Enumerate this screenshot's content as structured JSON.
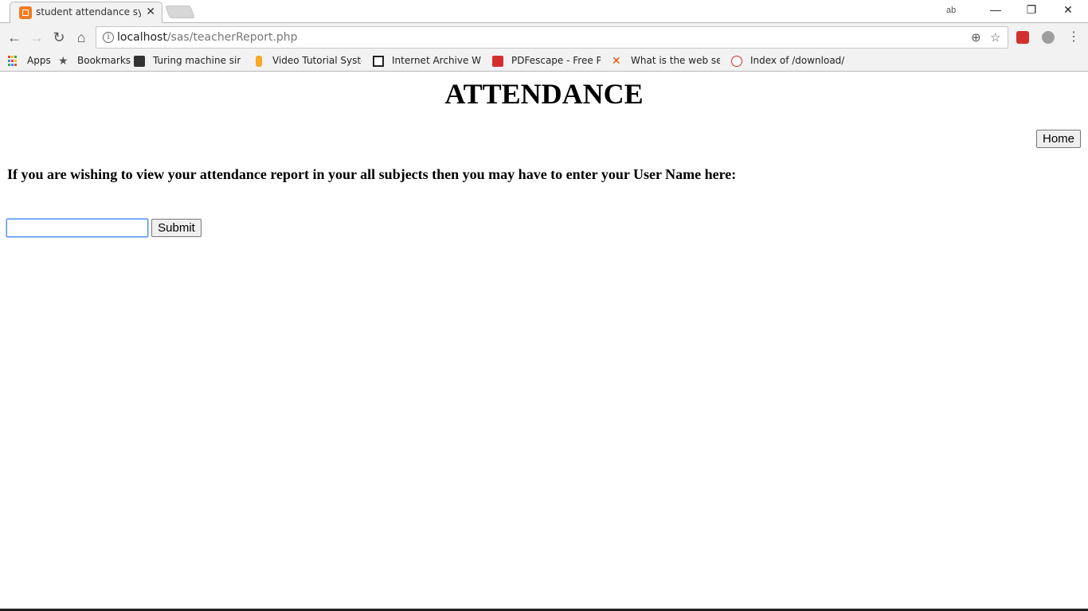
{
  "browser": {
    "tab": {
      "title": "student attendance system",
      "close_glyph": "✕"
    },
    "window_controls": {
      "minimize": "—",
      "restore": "❐",
      "close": "✕"
    },
    "profile_label": "ab",
    "toolbar": {
      "back": "←",
      "forward": "→",
      "reload": "↻",
      "home": "⌂",
      "url_host": "localhost",
      "url_path": "/sas/teacherReport.php",
      "info": "i",
      "zoom_icon": "⊕",
      "star_icon": "☆",
      "menu": "⋮"
    },
    "bookmarks": [
      {
        "label": "Apps",
        "icon": "apps-grid-icon"
      },
      {
        "label": "Bookmarks",
        "icon": "star-icon"
      },
      {
        "label": "Turing machine simu",
        "icon": "turing-icon"
      },
      {
        "label": "Video Tutorial Systen",
        "icon": "video-tutorial-icon"
      },
      {
        "label": "Internet Archive Wayb",
        "icon": "archive-icon"
      },
      {
        "label": "PDFescape - Free PDF",
        "icon": "pdfescape-icon"
      },
      {
        "label": "What is the web serve",
        "icon": "joomla-icon"
      },
      {
        "label": "Index of /download/",
        "icon": "index-icon"
      }
    ]
  },
  "page": {
    "heading": "ATTENDANCE",
    "home_button": "Home",
    "prompt": "If you are wishing to view your attendance report in your all subjects then you may have to enter your User Name here:",
    "username_value": "",
    "submit_button": "Submit"
  },
  "colors": {
    "favicon": "#f27b21",
    "focus_border": "#4d90fe",
    "chrome_bg": "#f2f2f2"
  }
}
